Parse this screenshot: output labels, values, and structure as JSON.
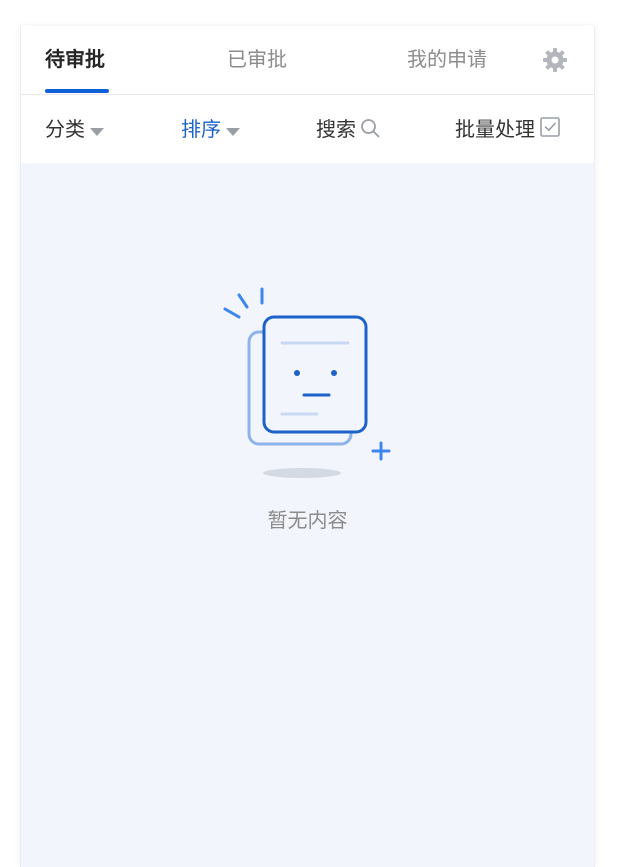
{
  "tabs": [
    {
      "label": "待审批",
      "active": true
    },
    {
      "label": "已审批",
      "active": false
    },
    {
      "label": "我的申请",
      "active": false
    }
  ],
  "settings_icon": "gear-icon",
  "filters": {
    "category": {
      "label": "分类",
      "icon": "caret-down-icon"
    },
    "sort": {
      "label": "排序",
      "icon": "caret-down-icon"
    },
    "search": {
      "label": "搜索",
      "icon": "search-icon"
    },
    "batch": {
      "label": "批量处理",
      "icon": "checkbox-icon"
    }
  },
  "empty_state": {
    "message": "暂无内容",
    "icon": "empty-document-icon"
  },
  "colors": {
    "accent": "#0f5fd8",
    "background": "#f2f5fb",
    "muted_text": "#8c8c8c"
  }
}
